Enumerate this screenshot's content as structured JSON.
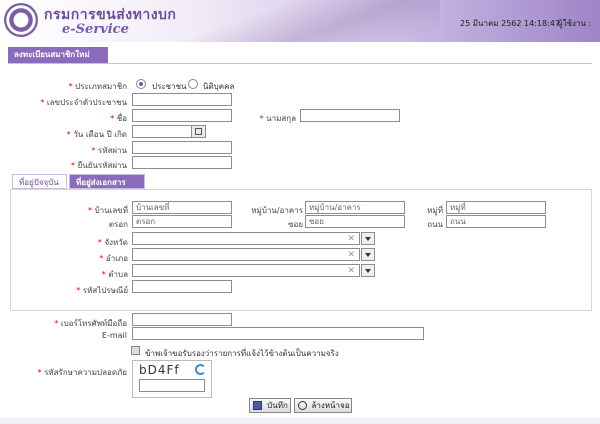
{
  "header": {
    "brand_th": "กรมการขนส่งทางบก",
    "brand_en": "e-Service",
    "datetime": "25 มีนาคม 2562 14:18:47",
    "user_label": "ผู้ใช้งาน :"
  },
  "page_title": "ลงทะเบียนสมาชิกใหม่",
  "member_type": {
    "label": "ประเภทสมาชิก",
    "options": [
      "ประชาชน",
      "นิติบุคคล"
    ],
    "selected": "ประชาชน"
  },
  "fields": {
    "id_card": "เลขประจำตัวประชาชน",
    "first_name": "ชื่อ",
    "last_name": "นามสกุล",
    "birth_date": "วัน เดือน ปี เกิด",
    "password": "รหัสผ่าน",
    "confirm_password": "ยืนยันรหัสผ่าน"
  },
  "tabs": [
    "ที่อยู่ปัจจุบัน",
    "ที่อยู่ส่งเอกสาร"
  ],
  "active_tab": "ที่อยู่ส่งเอกสาร",
  "address": {
    "house_no": {
      "label": "บ้านเลขที่",
      "placeholder": "บ้านเลขที่"
    },
    "village": {
      "label": "หมู่บ้าน/อาคาร",
      "placeholder": "หมู่บ้าน/อาคาร"
    },
    "moo": {
      "label": "หมู่ที่",
      "placeholder": "หมู่ที่"
    },
    "trok": {
      "label": "ตรอก",
      "placeholder": "ตรอก"
    },
    "soi": {
      "label": "ซอย",
      "placeholder": "ซอย"
    },
    "road": {
      "label": "ถนน",
      "placeholder": "ถนน"
    },
    "province": "จังหวัด",
    "district": "อำเภอ",
    "subdistrict": "ตำบล",
    "postcode": "รหัสไปรษณีย์"
  },
  "contact": {
    "mobile": "เบอร์โทรศัพท์มือถือ",
    "email": "E-mail"
  },
  "certify_text": "ข้าพเจ้าขอรับรองว่ารายการที่แจ้งไว้ข้างต้นเป็นความจริง",
  "captcha": {
    "label": "รหัสรักษาความปลอดภัย",
    "code": "bD4Ff"
  },
  "buttons": {
    "save": "บันทึก",
    "clear": "ล้างหน้าจอ"
  },
  "colors": {
    "accent": "#8a6bbd",
    "required": "#e60000"
  }
}
